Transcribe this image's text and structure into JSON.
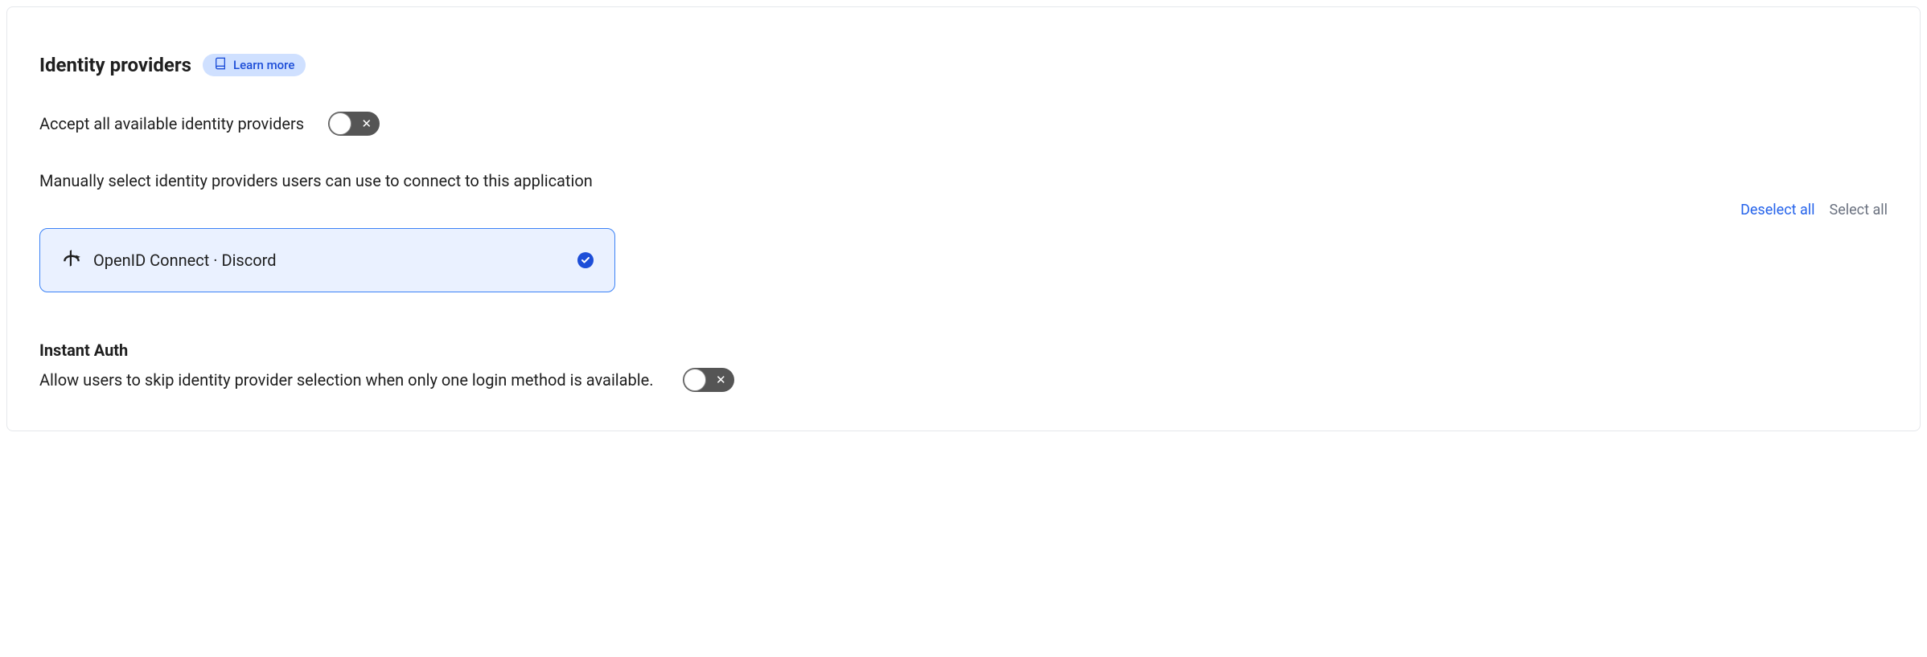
{
  "section": {
    "title": "Identity providers",
    "learnMore": "Learn more"
  },
  "acceptAll": {
    "label": "Accept all available identity providers",
    "enabled": false
  },
  "manualSelect": {
    "description": "Manually select identity providers users can use to connect to this application",
    "deselectAll": "Deselect all",
    "selectAll": "Select all"
  },
  "providers": [
    {
      "label": "OpenID Connect · Discord",
      "selected": true
    }
  ],
  "instantAuth": {
    "title": "Instant Auth",
    "description": "Allow users to skip identity provider selection when only one login method is available.",
    "enabled": false
  }
}
